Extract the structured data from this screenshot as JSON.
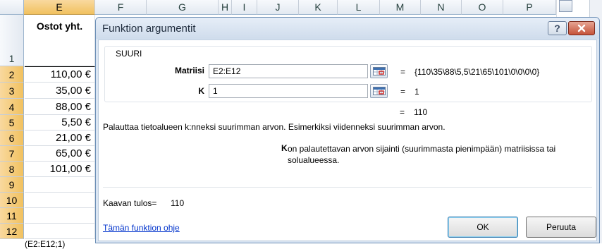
{
  "sheet": {
    "columns": [
      "E",
      "F",
      "G",
      "H",
      "I",
      "J",
      "K",
      "L",
      "M",
      "N",
      "O",
      "P"
    ],
    "rows": [
      "1",
      "2",
      "3",
      "4",
      "5",
      "6",
      "7",
      "8",
      "9",
      "10",
      "11",
      "12"
    ],
    "header_cell": "Ostot yht.",
    "values": [
      "110,00 €",
      "35,00 €",
      "88,00 €",
      "5,50 €",
      "21,00 €",
      "65,00 €",
      "101,00 €",
      "",
      "",
      "",
      ""
    ],
    "bottom_text": "(E2:E12;1)"
  },
  "dialog": {
    "title": "Funktion argumentit",
    "help_button": "?",
    "function_name": "SUURI",
    "args": [
      {
        "label": "Matriisi",
        "value": "E2:E12",
        "result": "{110\\35\\88\\5,5\\21\\65\\101\\0\\0\\0\\0}"
      },
      {
        "label": "K",
        "value": "1",
        "result": "1"
      }
    ],
    "equals": "=",
    "function_result": "110",
    "description": "Palauttaa tietoalueen k:nneksi suurimman arvon. Esimerkiksi viidenneksi suurimman arvon.",
    "arg_desc_label": "K",
    "arg_desc": "on palautettavan arvon sijainti (suurimmasta pienimpään) matriisissa tai solualueessa.",
    "formula_result_label": "Kaavan tulos=",
    "formula_result_value": "110",
    "help_link": "Tämän funktion ohje",
    "ok": "OK",
    "cancel": "Peruuta"
  }
}
